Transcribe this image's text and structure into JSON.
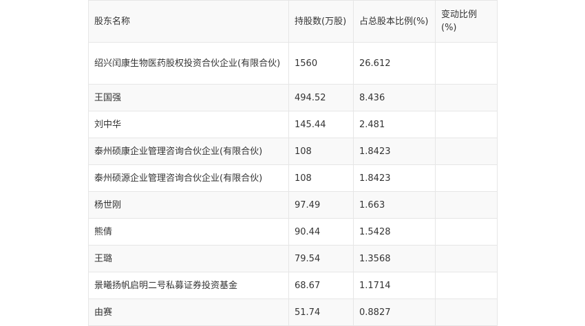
{
  "table": {
    "headers": [
      "股东名称",
      "持股数(万股)",
      "占总股本比例(%)",
      "变动比例(%)"
    ],
    "rows": [
      [
        "绍兴闰康生物医药股权投资合伙企业(有限合伙)",
        "1560",
        "26.612",
        ""
      ],
      [
        "王国强",
        "494.52",
        "8.436",
        ""
      ],
      [
        "刘中华",
        "145.44",
        "2.481",
        ""
      ],
      [
        "泰州硕康企业管理咨询合伙企业(有限合伙)",
        "108",
        "1.8423",
        ""
      ],
      [
        "泰州硕源企业管理咨询合伙企业(有限合伙)",
        "108",
        "1.8423",
        ""
      ],
      [
        "杨世刚",
        "97.49",
        "1.663",
        ""
      ],
      [
        "熊倩",
        "90.44",
        "1.5428",
        ""
      ],
      [
        "王璐",
        "79.54",
        "1.3568",
        ""
      ],
      [
        "景曦扬帆启明二号私募证券投资基金",
        "68.67",
        "1.1714",
        ""
      ],
      [
        "由赛",
        "51.74",
        "0.8827",
        ""
      ]
    ]
  }
}
